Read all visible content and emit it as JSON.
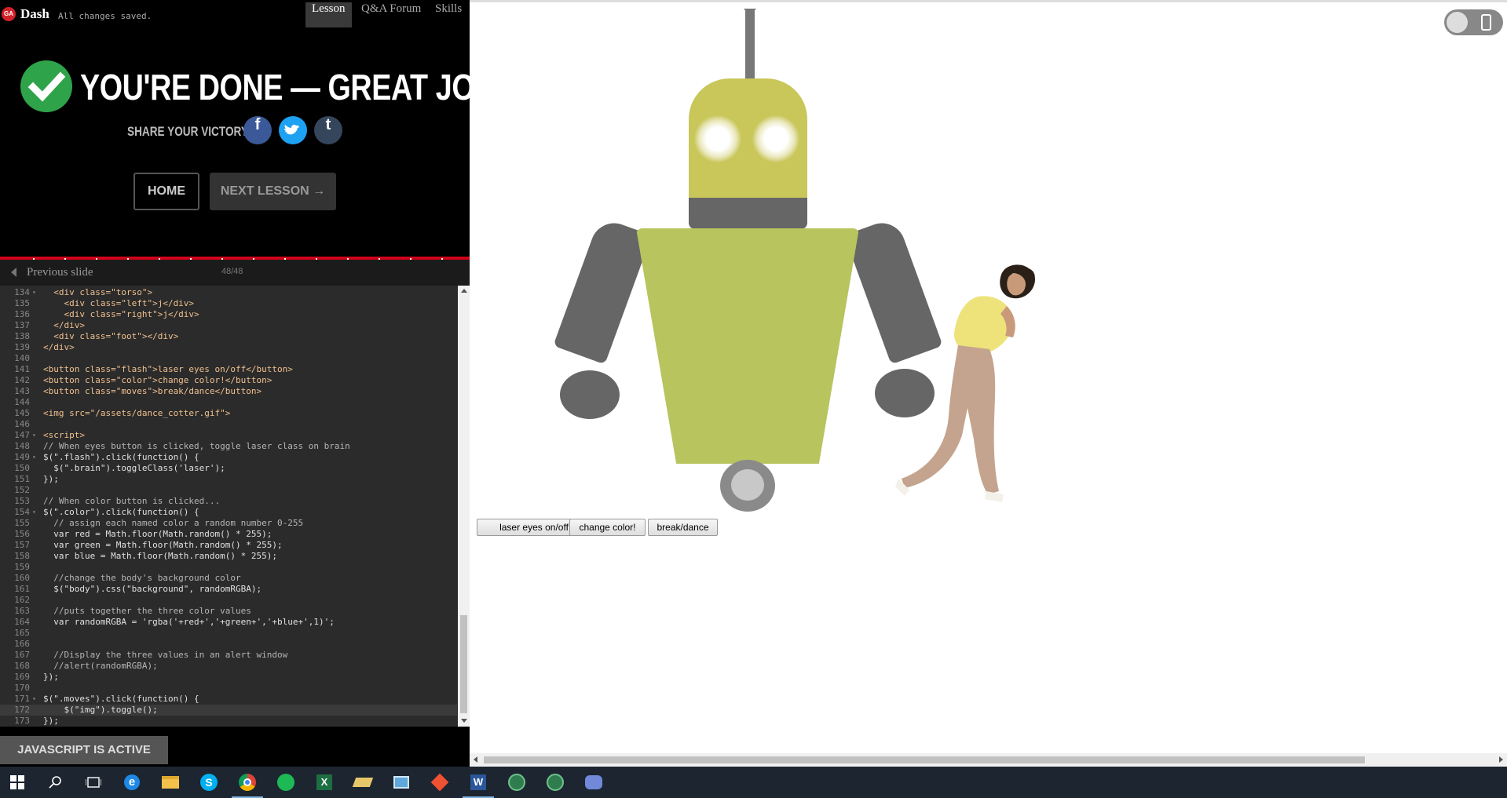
{
  "header": {
    "logo_text": "GA",
    "app_name": "Dash",
    "save_status": "All changes saved.",
    "tabs": [
      {
        "label": "Lesson"
      },
      {
        "label": "Q&A Forum"
      },
      {
        "label": "Skills"
      }
    ]
  },
  "completion": {
    "title": "YOU'RE DONE — GREAT JOB!",
    "share_label": "SHARE YOUR VICTORY:",
    "share": [
      {
        "glyph": "f",
        "color": "#3b5998"
      },
      {
        "glyph": "🐦",
        "color": "#1da1f2"
      },
      {
        "glyph": "t",
        "color": "#35465c"
      }
    ],
    "home_label": "HOME",
    "next_label": "NEXT LESSON →"
  },
  "slides": {
    "prev_label": "Previous slide",
    "counter": "48/48"
  },
  "editor": {
    "lines": [
      {
        "n": "134",
        "fold": "▾",
        "code": "  <div class=\"torso\">"
      },
      {
        "n": "135",
        "fold": "",
        "code": "    <div class=\"left\">j</div>"
      },
      {
        "n": "136",
        "fold": "",
        "code": "    <div class=\"right\">j</div>"
      },
      {
        "n": "137",
        "fold": "",
        "code": "  </div>"
      },
      {
        "n": "138",
        "fold": "",
        "code": "  <div class=\"foot\"></div>"
      },
      {
        "n": "139",
        "fold": "",
        "code": "</div>"
      },
      {
        "n": "140",
        "fold": "",
        "code": ""
      },
      {
        "n": "141",
        "fold": "",
        "code": "<button class=\"flash\">laser eyes on/off</button>"
      },
      {
        "n": "142",
        "fold": "",
        "code": "<button class=\"color\">change color!</button>"
      },
      {
        "n": "143",
        "fold": "",
        "code": "<button class=\"moves\">break/dance</button>"
      },
      {
        "n": "144",
        "fold": "",
        "code": ""
      },
      {
        "n": "145",
        "fold": "",
        "code": "<img src=\"/assets/dance_cotter.gif\">"
      },
      {
        "n": "146",
        "fold": "",
        "code": ""
      },
      {
        "n": "147",
        "fold": "▾",
        "code": "<script>"
      },
      {
        "n": "148",
        "fold": "",
        "code": "// When eyes button is clicked, toggle laser class on brain"
      },
      {
        "n": "149",
        "fold": "▾",
        "code": "$(\".flash\").click(function() {"
      },
      {
        "n": "150",
        "fold": "",
        "code": "  $(\".brain\").toggleClass('laser');"
      },
      {
        "n": "151",
        "fold": "",
        "code": "});"
      },
      {
        "n": "152",
        "fold": "",
        "code": ""
      },
      {
        "n": "153",
        "fold": "",
        "code": "// When color button is clicked..."
      },
      {
        "n": "154",
        "fold": "▾",
        "code": "$(\".color\").click(function() {"
      },
      {
        "n": "155",
        "fold": "",
        "code": "  // assign each named color a random number 0-255"
      },
      {
        "n": "156",
        "fold": "",
        "code": "  var red = Math.floor(Math.random() * 255);"
      },
      {
        "n": "157",
        "fold": "",
        "code": "  var green = Math.floor(Math.random() * 255);"
      },
      {
        "n": "158",
        "fold": "",
        "code": "  var blue = Math.floor(Math.random() * 255);"
      },
      {
        "n": "159",
        "fold": "",
        "code": ""
      },
      {
        "n": "160",
        "fold": "",
        "code": "  //change the body's background color"
      },
      {
        "n": "161",
        "fold": "",
        "code": "  $(\"body\").css(\"background\", randomRGBA);"
      },
      {
        "n": "162",
        "fold": "",
        "code": ""
      },
      {
        "n": "163",
        "fold": "",
        "code": "  //puts together the three color values"
      },
      {
        "n": "164",
        "fold": "",
        "code": "  var randomRGBA = 'rgba('+red+','+green+','+blue+',1)';"
      },
      {
        "n": "165",
        "fold": "",
        "code": ""
      },
      {
        "n": "166",
        "fold": "",
        "code": ""
      },
      {
        "n": "167",
        "fold": "",
        "code": "  //Display the three values in an alert window"
      },
      {
        "n": "168",
        "fold": "",
        "code": "  //alert(randomRGBA);"
      },
      {
        "n": "169",
        "fold": "",
        "code": "});"
      },
      {
        "n": "170",
        "fold": "",
        "code": ""
      },
      {
        "n": "171",
        "fold": "▾",
        "code": "$(\".moves\").click(function() {"
      },
      {
        "n": "172",
        "fold": "",
        "code": "    $(\"img\").toggle();"
      },
      {
        "n": "173",
        "fold": "",
        "code": "});"
      }
    ],
    "current_line": "172"
  },
  "js_status": "JAVASCRIPT IS ACTIVE",
  "preview": {
    "buttons": [
      {
        "label": "laser eyes on/off"
      },
      {
        "label": "change color!"
      },
      {
        "label": "break/dance"
      }
    ]
  },
  "taskbar": {
    "icons": [
      "windows-start-icon",
      "search-icon",
      "task-view-icon",
      "edge-icon",
      "file-explorer-icon",
      "skype-icon",
      "chrome-icon",
      "spotify-icon",
      "excel-icon",
      "notes-icon",
      "remote-desktop-icon",
      "git-icon",
      "word-icon",
      "atom-icon",
      "atom-icon",
      "discord-icon"
    ]
  },
  "colors": {
    "accent_red": "#d0021b",
    "success_green": "#2fa34a",
    "robot_head": "#c9c65a",
    "robot_torso": "#b8c45e",
    "robot_limbs": "#666666"
  }
}
